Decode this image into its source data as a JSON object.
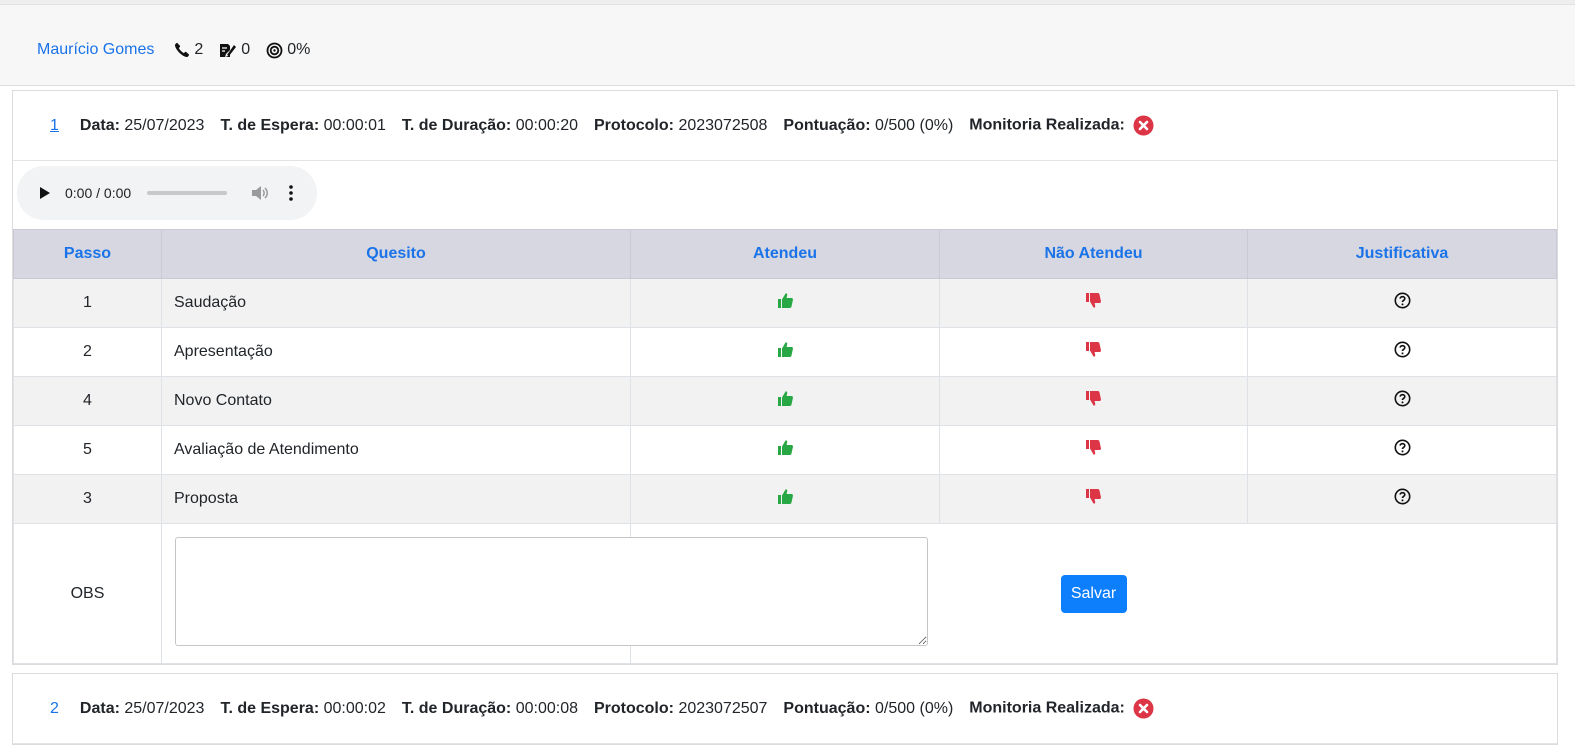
{
  "header": {
    "agent_name": "Maurício Gomes",
    "calls": "2",
    "reviews": "0",
    "score": "0%"
  },
  "records": [
    {
      "number": "1",
      "data_label": "Data:",
      "data_value": "25/07/2023",
      "espera_label": "T. de Espera:",
      "espera_value": "00:00:01",
      "duracao_label": "T. de Duração:",
      "duracao_value": "00:00:20",
      "protocolo_label": "Protocolo:",
      "protocolo_value": "2023072508",
      "pontuacao_label": "Pontuação:",
      "pontuacao_value": "0/500 (0%)",
      "monitoria_label": "Monitoria Realizada:"
    },
    {
      "number": "2",
      "data_label": "Data:",
      "data_value": "25/07/2023",
      "espera_label": "T. de Espera:",
      "espera_value": "00:00:02",
      "duracao_label": "T. de Duração:",
      "duracao_value": "00:00:08",
      "protocolo_label": "Protocolo:",
      "protocolo_value": "2023072507",
      "pontuacao_label": "Pontuação:",
      "pontuacao_value": "0/500 (0%)",
      "monitoria_label": "Monitoria Realizada:"
    }
  ],
  "audio": {
    "time": "0:00 / 0:00"
  },
  "table": {
    "headers": [
      "Passo",
      "Quesito",
      "Atendeu",
      "Não Atendeu",
      "Justificativa"
    ],
    "rows": [
      {
        "passo": "1",
        "quesito": "Saudação"
      },
      {
        "passo": "2",
        "quesito": "Apresentação"
      },
      {
        "passo": "4",
        "quesito": "Novo Contato"
      },
      {
        "passo": "5",
        "quesito": "Avaliação de Atendimento"
      },
      {
        "passo": "3",
        "quesito": "Proposta"
      }
    ],
    "obs_label": "OBS",
    "obs_value": "",
    "save_label": "Salvar"
  },
  "icons": {
    "phone": "phone-icon",
    "review": "signature-icon",
    "score": "target-icon",
    "status_failed": "x-circle-icon",
    "approve": "thumbs-up-icon",
    "reject": "thumbs-down-icon",
    "justify": "question-circle-icon"
  },
  "colors": {
    "link": "#1a73e8",
    "approve": "#28a745",
    "reject": "#dc3545",
    "header_bg": "#d6d7e1",
    "button": "#0d7efc"
  }
}
